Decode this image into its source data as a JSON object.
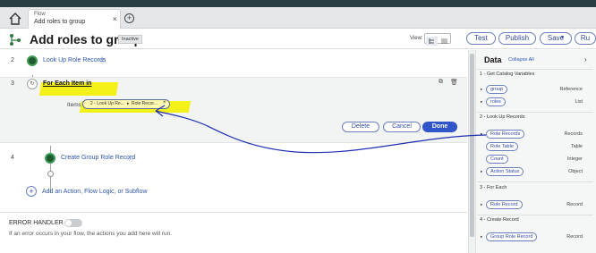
{
  "tab": {
    "subtitle": "Flow",
    "title": "Add roles to group",
    "close": "×",
    "new_tab": "+"
  },
  "header": {
    "title": "Add roles to group",
    "status": "Inactive",
    "view_label": "View:",
    "test": "Test",
    "publish": "Publish",
    "save": "Save",
    "more": "Ru"
  },
  "steps": [
    {
      "num": "2",
      "label": "Look Up Role Records"
    },
    {
      "num": "3",
      "label": "For Each Item in"
    },
    {
      "num": "4",
      "label": "Create Group Role Record"
    }
  ],
  "foreach": {
    "items_label": "Items",
    "pill_left": "2 - Look Up Re...",
    "pill_sep": "▸",
    "pill_right": "Role Recor...",
    "pill_remove": "×",
    "delete": "Delete",
    "cancel": "Cancel",
    "done": "Done"
  },
  "add_link": "Add an Action, Flow Logic, or Subflow",
  "error_handler": {
    "title": "ERROR HANDLER",
    "desc": "If an error occurs in your flow, the actions you add here will run."
  },
  "data_panel": {
    "title": "Data",
    "collapse_all": "Collapse All",
    "sections": [
      {
        "title": "1 - Get Catalog Variables",
        "items": [
          {
            "label": "group",
            "type": "Reference"
          },
          {
            "label": "roles",
            "type": "List"
          }
        ]
      },
      {
        "title": "2 - Look Up Records",
        "items": [
          {
            "label": "Role Records",
            "type": "Records"
          },
          {
            "label": "Role Table",
            "type": "Table"
          },
          {
            "label": "Count",
            "type": "Integer"
          },
          {
            "label": "Action Status",
            "type": "Object"
          }
        ]
      },
      {
        "title": "3 - For Each",
        "items": [
          {
            "label": "Role Record",
            "type": "Record"
          }
        ]
      },
      {
        "title": "4 - Create Record",
        "items": [
          {
            "label": "Group Role Record",
            "type": "Record"
          }
        ]
      }
    ]
  },
  "colors": {
    "accent": "#2f55c8",
    "highlight": "#f3f117",
    "annotation": "#1f2fb0",
    "step_green": "#3f9d56"
  }
}
